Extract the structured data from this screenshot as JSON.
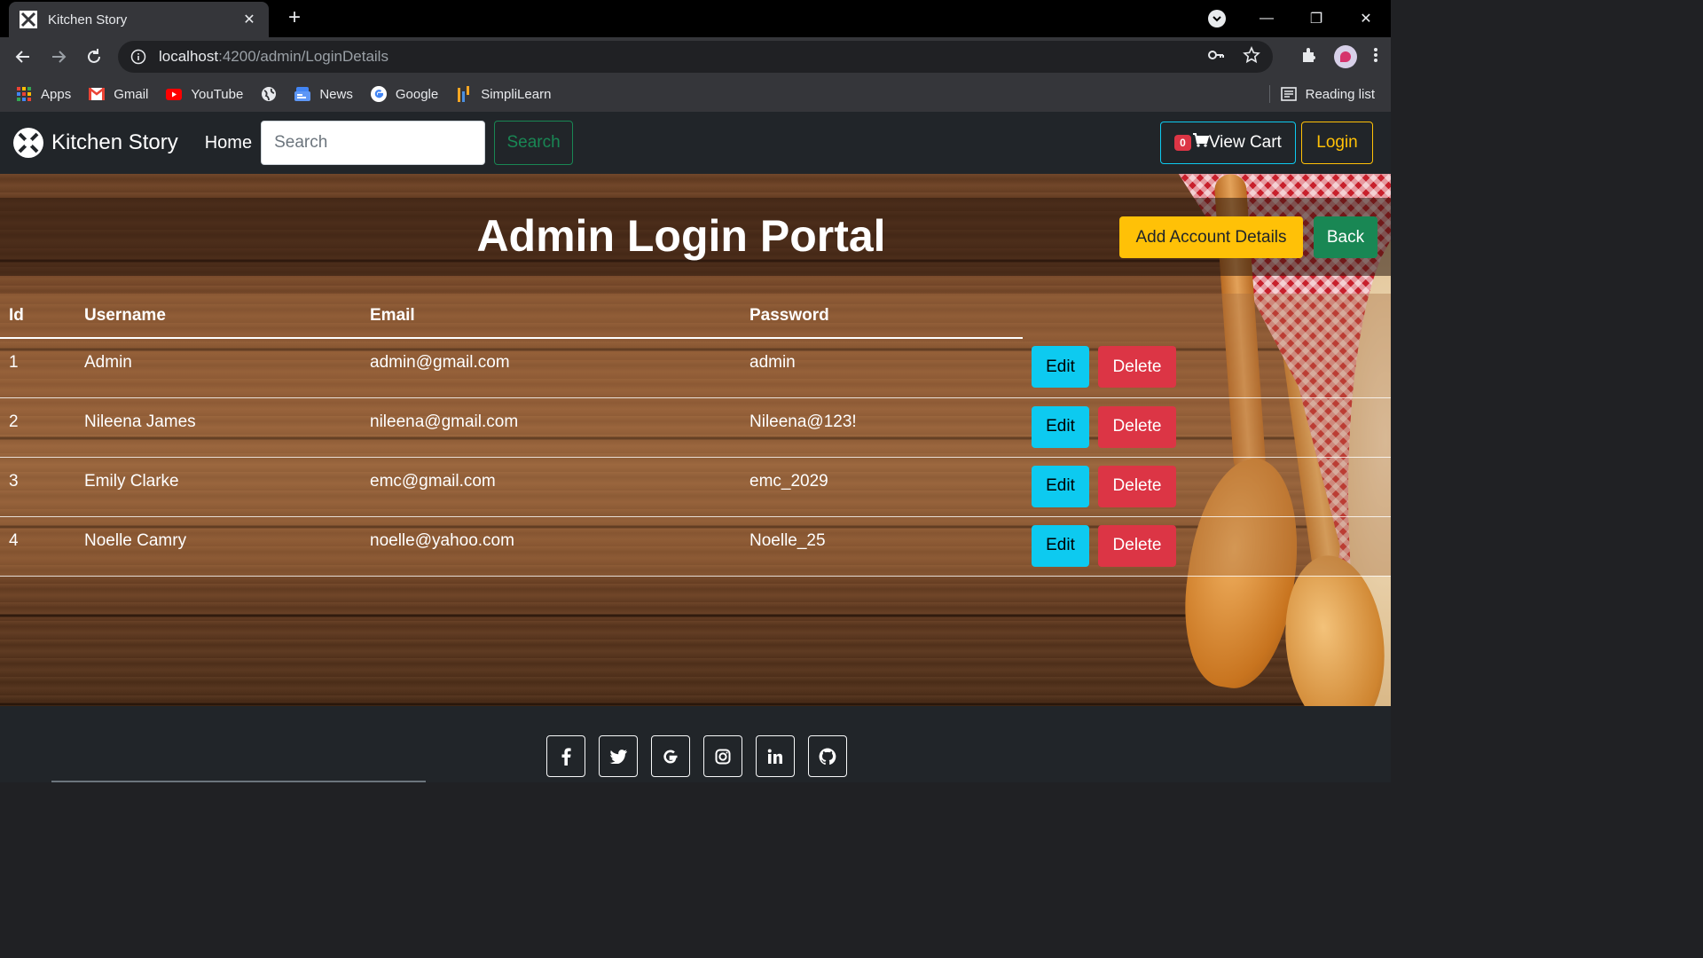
{
  "browser": {
    "tab_title": "Kitchen Story",
    "url_host": "localhost",
    "url_rest": ":4200/admin/LoginDetails",
    "bookmarks": [
      {
        "label": "Apps",
        "icon": "apps-grid-icon"
      },
      {
        "label": "Gmail",
        "icon": "gmail-icon"
      },
      {
        "label": "YouTube",
        "icon": "youtube-icon"
      },
      {
        "label": "",
        "icon": "globe-icon"
      },
      {
        "label": "News",
        "icon": "news-icon"
      },
      {
        "label": "Google",
        "icon": "google-icon"
      },
      {
        "label": "SimpliLearn",
        "icon": "simplilearn-icon"
      }
    ],
    "reading_list": "Reading list"
  },
  "navbar": {
    "brand": "Kitchen Story",
    "home": "Home",
    "search_placeholder": "Search",
    "search_button": "Search",
    "cart_count": "0",
    "cart_label": "View Cart",
    "login": "Login"
  },
  "page": {
    "title": "Admin Login Portal",
    "add_button": "Add Account Details",
    "back_button": "Back"
  },
  "table": {
    "headers": [
      "Id",
      "Username",
      "Email",
      "Password"
    ],
    "rows": [
      {
        "id": "1",
        "username": "Admin",
        "email": "admin@gmail.com",
        "password": "admin"
      },
      {
        "id": "2",
        "username": "Nileena James",
        "email": "nileena@gmail.com",
        "password": "Nileena@123!"
      },
      {
        "id": "3",
        "username": "Emily Clarke",
        "email": "emc@gmail.com",
        "password": "emc_2029"
      },
      {
        "id": "4",
        "username": "Noelle Camry",
        "email": "noelle@yahoo.com",
        "password": "Noelle_25"
      }
    ],
    "edit_label": "Edit",
    "delete_label": "Delete"
  },
  "footer": {
    "socials": [
      "facebook-icon",
      "twitter-icon",
      "google-icon",
      "instagram-icon",
      "linkedin-icon",
      "github-icon"
    ]
  },
  "colors": {
    "edit": "#0dcaf0",
    "delete": "#dc3545",
    "add": "#ffc107",
    "back": "#198754",
    "navbar": "#212529"
  }
}
